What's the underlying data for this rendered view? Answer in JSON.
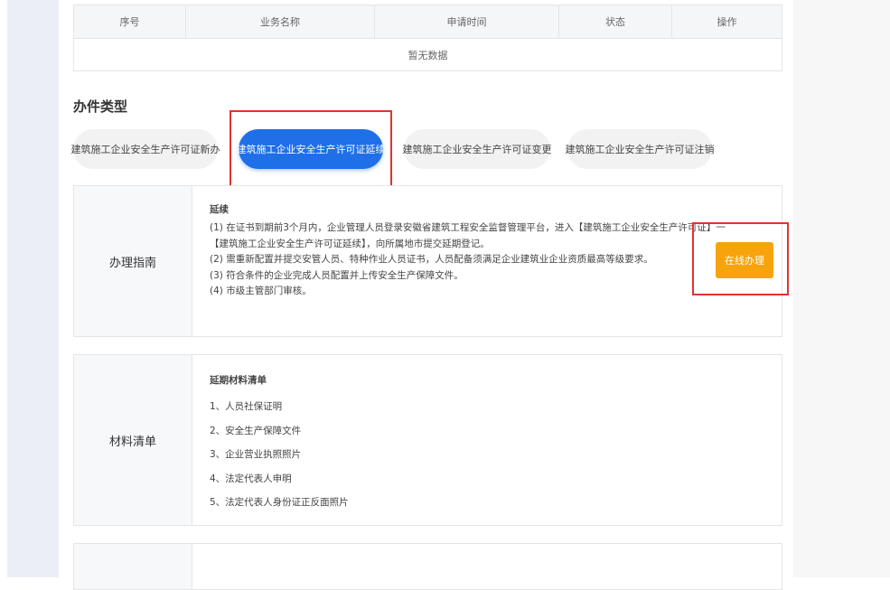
{
  "table": {
    "columns": [
      "序号",
      "业务名称",
      "申请时间",
      "状态",
      "操作"
    ],
    "empty_text": "暂无数据"
  },
  "section_title": "办件类型",
  "types": [
    {
      "label": "建筑施工企业安全生产许可证新办",
      "active": false
    },
    {
      "label": "建筑施工企业安全生产许可证延续",
      "active": true
    },
    {
      "label": "建筑施工企业安全生产许可证变更",
      "active": false
    },
    {
      "label": "建筑施工企业安全生产许可证注销",
      "active": false
    }
  ],
  "guide": {
    "label": "办理指南",
    "title": "延续",
    "lines": [
      "(1) 在证书到期前3个月内，企业管理人员登录安徽省建筑工程安全监督管理平台，进入【建筑施工企业安全生产许可证】一",
      "【建筑施工企业安全生产许可证延续】，向所属地市提交延期登记。",
      "(2) 需重新配置并提交安管人员、特种作业人员证书，人员配备须满足企业建筑业企业资质最高等级要求。",
      "(3) 符合条件的企业完成人员配置并上传安全生产保障文件。",
      "(4) 市级主管部门审核。"
    ],
    "button": "在线办理"
  },
  "materials": {
    "label": "材料清单",
    "title": "延期材料清单",
    "items": [
      "1、人员社保证明",
      "2、安全生产保障文件",
      "3、企业营业执照照片",
      "4、法定代表人申明",
      "5、法定代表人身份证正反面照片"
    ]
  },
  "colors": {
    "primary": "#1e6fe8",
    "orange": "#f7a30c",
    "highlight_red": "#e5312f"
  }
}
